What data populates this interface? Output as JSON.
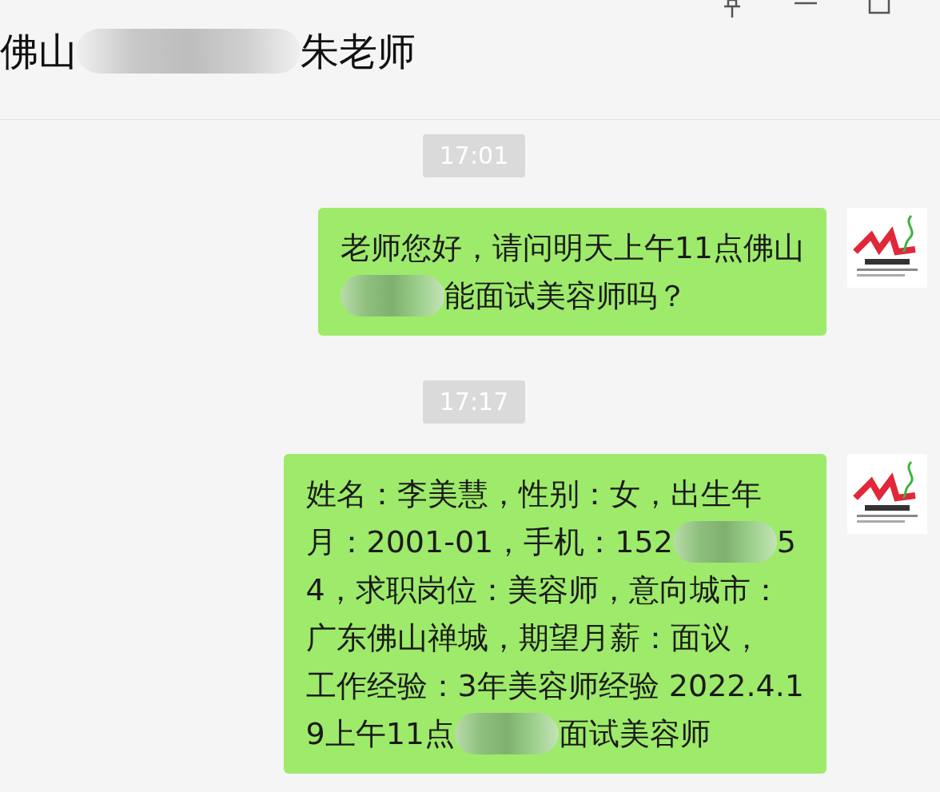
{
  "window": {
    "title_segments": [
      {
        "kind": "text",
        "text": "佛山"
      },
      {
        "kind": "redacted"
      },
      {
        "kind": "text",
        "text": "朱老师"
      }
    ]
  },
  "messages": [
    {
      "kind": "time",
      "text": "17:01"
    },
    {
      "kind": "bubble",
      "lines": [
        [
          {
            "kind": "text",
            "text": "老师您好，请问明天上午11点佛山"
          }
        ],
        [
          {
            "kind": "redacted"
          },
          {
            "kind": "text",
            "text": "能面试美容师吗？"
          }
        ]
      ]
    },
    {
      "kind": "time",
      "text": "17:17"
    },
    {
      "kind": "bubble",
      "lines": [
        [
          {
            "kind": "text",
            "text": "姓名：李美慧，性别：女，出生年"
          }
        ],
        [
          {
            "kind": "text",
            "text": "月：2001-01，手机：152"
          },
          {
            "kind": "redacted"
          },
          {
            "kind": "text",
            "text": "5"
          }
        ],
        [
          {
            "kind": "text",
            "text": "4，求职岗位：美容师，意向城市："
          }
        ],
        [
          {
            "kind": "text",
            "text": "广东佛山禅城，期望月薪：面议，"
          }
        ],
        [
          {
            "kind": "text",
            "text": "工作经验：3年美容师经验 2022.4.1"
          }
        ],
        [
          {
            "kind": "text",
            "text": "9上午11点"
          },
          {
            "kind": "redacted"
          },
          {
            "kind": "text",
            "text": "面试美容师"
          }
        ]
      ]
    }
  ]
}
